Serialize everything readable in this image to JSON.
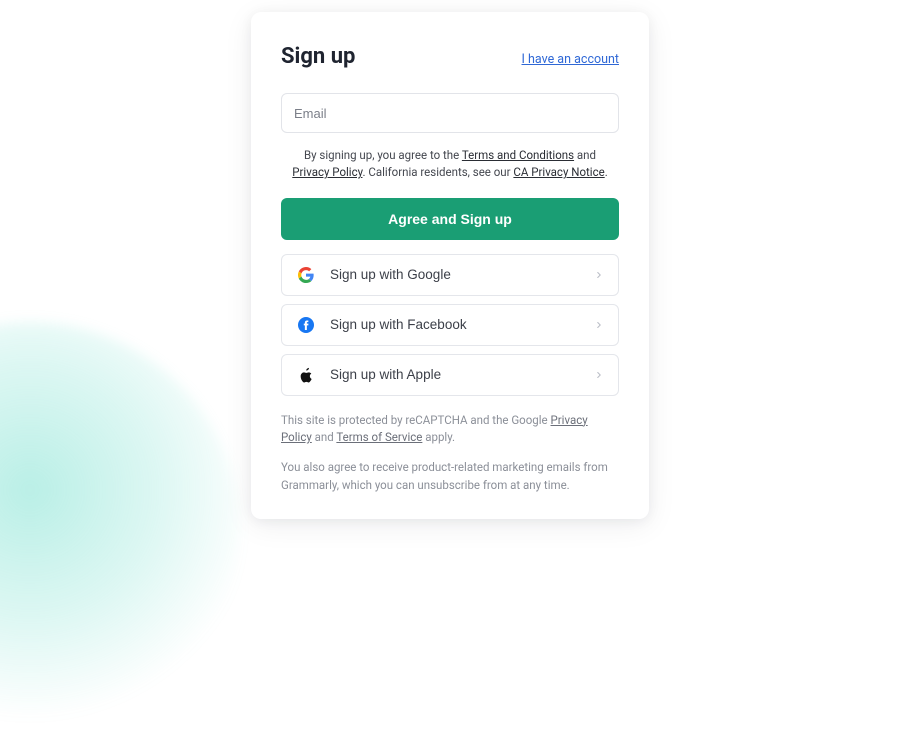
{
  "header": {
    "title": "Sign up",
    "have_account": "I have an account"
  },
  "form": {
    "email_placeholder": "Email"
  },
  "terms": {
    "pre": "By signing up, you agree to the ",
    "terms_link": "Terms and Conditions",
    "and1": " and ",
    "privacy_link": "Privacy Policy",
    "ca_pre": ". California residents, see our ",
    "ca_link": "CA Privacy Notice",
    "end": "."
  },
  "buttons": {
    "primary": "Agree and Sign up",
    "google": "Sign up with Google",
    "facebook": "Sign up with Facebook",
    "apple": "Sign up with Apple"
  },
  "footer1": {
    "pre": "This site is protected by reCAPTCHA and the Google ",
    "privacy": "Privacy Policy",
    "mid": " and ",
    "tos": "Terms of Service",
    "end": " apply."
  },
  "footer2": "You also agree to receive product-related marketing emails from Grammarly, which you can unsubscribe from at any time."
}
